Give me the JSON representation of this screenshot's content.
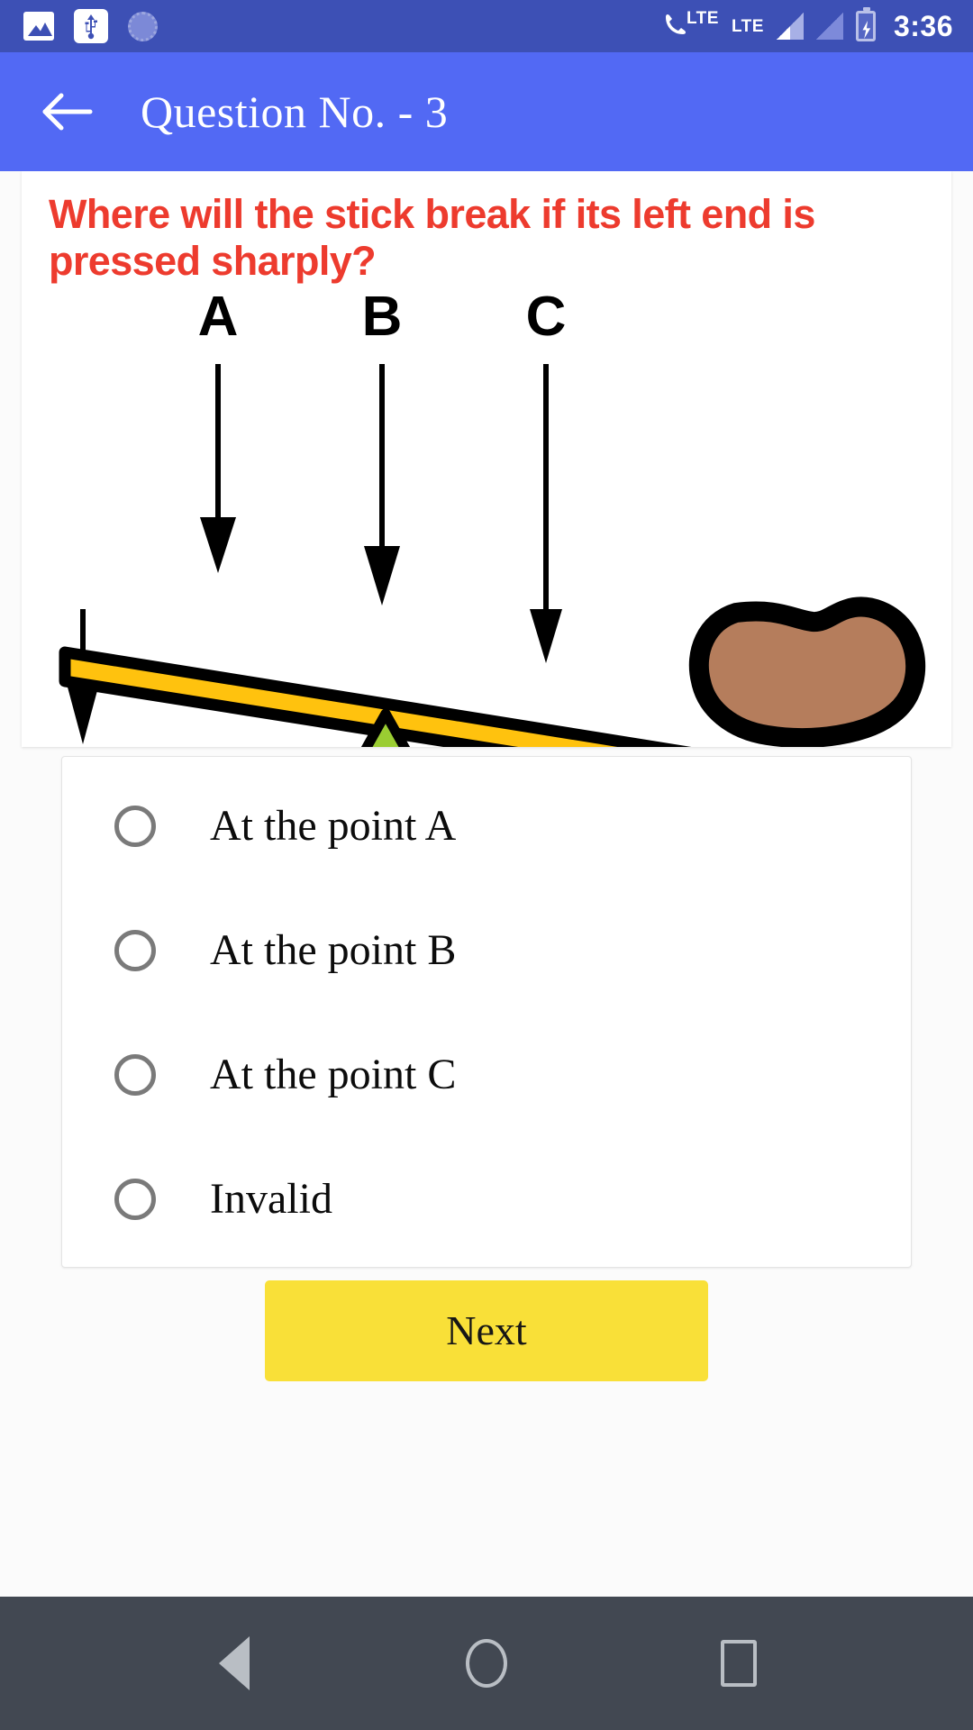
{
  "status_bar": {
    "icons_left": [
      "photo-icon",
      "usb-icon",
      "spinner-icon"
    ],
    "icons_right": [
      "volte-lte-icon",
      "lte-icon",
      "signal-full-icon",
      "signal-empty-icon",
      "battery-charging-icon"
    ],
    "volte_label": "LTE",
    "lte_label": "LTE",
    "time": "3:36"
  },
  "app_bar": {
    "back_icon": "back-arrow-icon",
    "title": "Question No. - 3"
  },
  "question": {
    "text": "Where will the stick break if its left end is pressed sharply?",
    "color": "#ED3B2E"
  },
  "diagram": {
    "labels": [
      "A",
      "B",
      "C"
    ],
    "stick_color": "#FFC20E",
    "fulcrum_color": "#9ACD32",
    "rock_color": "#B57D5C",
    "outline_color": "#000000",
    "arrow_count": 4,
    "description": "A yellow stick rests on a green triangular fulcrum, tilted down to the right where a brown rock presses it; downward arrows mark points A, B, C and the free left end."
  },
  "options": [
    {
      "label": "At the point A",
      "selected": false
    },
    {
      "label": "At the point B",
      "selected": false
    },
    {
      "label": "At the point C",
      "selected": false
    },
    {
      "label": "Invalid",
      "selected": false
    }
  ],
  "next_button": {
    "label": "Next",
    "color": "#F9E038"
  },
  "nav_bar": {
    "buttons": [
      "back-triangle-icon",
      "home-circle-icon",
      "recents-square-icon"
    ]
  }
}
